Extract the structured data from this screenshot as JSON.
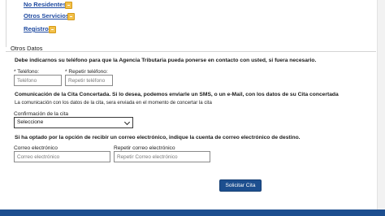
{
  "nav": {
    "links": [
      "No Residentes",
      "Otros Servicios",
      "Registro"
    ]
  },
  "section": {
    "legend": "Otros Datos",
    "phone_intro": "Debe indicarnos su teléfono para que la Agencia Tributaria pueda ponerse en contacto con usted, si fuera necesario.",
    "phone_label": "* Teléfono:",
    "phone_placeholder": "Teléfono",
    "phone_repeat_label": "* Repetir teléfono:",
    "phone_repeat_placeholder": "Repetir teléfono",
    "notify_heading": "Comunicación de la Cita Concertada. Si lo desea, podemos enviarle un SMS, o un e-Mail, con los datos de su Cita concertada",
    "notify_sub": "La comunicación con los datos de la cita, sera enviada en el momento de concertar la cita",
    "confirm_label": "Confirmación de la cita",
    "confirm_selected": "Seleccione",
    "email_intro": "Si ha optado por la opción de recibir un correo electrónico, indique la cuenta de correo electrónico de destino.",
    "email_label": "Correo electrónico",
    "email_placeholder": "Correo electrónico",
    "email_repeat_label": "Repetir correo electrónico",
    "email_repeat_placeholder": "Repetir Correo electrónico"
  },
  "actions": {
    "submit_label": "Solicitar Cita"
  },
  "colors": {
    "link": "#1f4aa0",
    "primary_button": "#1d4f8f",
    "footer_bar": "#1d4e8f",
    "icon": "#f2c04a"
  }
}
